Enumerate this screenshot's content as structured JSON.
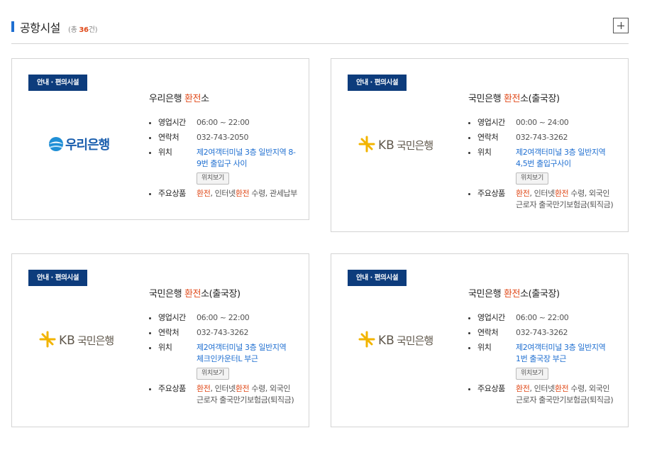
{
  "section": {
    "title": "공항시설",
    "count_prefix": "(총 ",
    "count_number": "36",
    "count_suffix": "건)"
  },
  "labels": {
    "hours": "영업시간",
    "phone": "연락처",
    "location": "위치",
    "products": "주요상품",
    "map_button": "위치보기"
  },
  "colors": {
    "accent": "#1f6fd1",
    "highlight": "#e04a1a",
    "tag_bg": "#0d3c7c"
  },
  "cards": [
    {
      "tag": "안내 · 편의시설",
      "logo_text": "우리은행",
      "name_pre": "우리은행 ",
      "name_hl": "환전",
      "name_post": "소",
      "hours": "06:00 ~ 22:00",
      "phone": "032-743-2050",
      "location_1": "제2여객터미널 3층 일반지역 8-",
      "location_2": "9번 출입구 사이",
      "products_hl1": "환전",
      "products_mid": ", 인터넷",
      "products_hl2": "환전",
      "products_post": " 수령, 관세납부"
    },
    {
      "tag": "안내 · 편의시설",
      "logo_kb": "KB",
      "logo_text": "국민은행",
      "name_pre": "국민은행 ",
      "name_hl": "환전",
      "name_post": "소(출국장)",
      "hours": "00:00 ~ 24:00",
      "phone": "032-743-3262",
      "location_1": "제2여객터미널 3층 일반지역",
      "location_2": "4,5번 출입구사이",
      "products_hl1": "환전",
      "products_mid": ", 인터넷",
      "products_hl2": "환전",
      "products_post": " 수령, 외국인",
      "products_line2": "근로자 출국만기보험금(퇴직금)"
    },
    {
      "tag": "안내 · 편의시설",
      "logo_kb": "KB",
      "logo_text": "국민은행",
      "name_pre": "국민은행 ",
      "name_hl": "환전",
      "name_post": "소(출국장)",
      "hours": "06:00 ~ 22:00",
      "phone": "032-743-3262",
      "location_1": "제2여객터미널 3층 일반지역",
      "location_2": "체크인카운터L 부근",
      "products_hl1": "환전",
      "products_mid": ", 인터넷",
      "products_hl2": "환전",
      "products_post": " 수령, 외국인",
      "products_line2": "근로자 출국만기보험금(퇴직금)"
    },
    {
      "tag": "안내 · 편의시설",
      "logo_kb": "KB",
      "logo_text": "국민은행",
      "name_pre": "국민은행 ",
      "name_hl": "환전",
      "name_post": "소(출국장)",
      "hours": "06:00 ~ 22:00",
      "phone": "032-743-3262",
      "location_1": "제2여객터미널 3층 일반지역",
      "location_2": "1번 출국장 부근",
      "products_hl1": "환전",
      "products_mid": ", 인터넷",
      "products_hl2": "환전",
      "products_post": " 수령, 외국인",
      "products_line2": "근로자 출국만기보험금(퇴직금)"
    }
  ]
}
